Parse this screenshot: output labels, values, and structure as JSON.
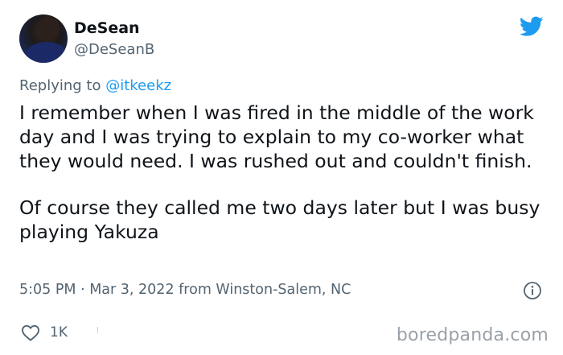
{
  "author": {
    "name": "DeSean",
    "handle": "@DeSeanB"
  },
  "reply": {
    "prefix": "Replying to ",
    "mention": "@itkeekz"
  },
  "body": {
    "paragraph_1": "I remember when I was fired in the middle of the work day and I was trying to explain to my co-worker what they would need. I was rushed out and couldn't finish.",
    "paragraph_2": "Of course they called me two days later but I was busy playing Yakuza"
  },
  "meta": {
    "text": "5:05 PM · Mar 3, 2022 from Winston-Salem, NC"
  },
  "actions": {
    "like_count": "1K"
  },
  "watermark": "boredpanda.com",
  "colors": {
    "accent": "#1d9bf0",
    "secondary_text": "#536471",
    "primary_text": "#0f1419"
  },
  "icons": {
    "brand": "twitter-bird-icon",
    "info": "info-icon",
    "like": "heart-icon"
  }
}
